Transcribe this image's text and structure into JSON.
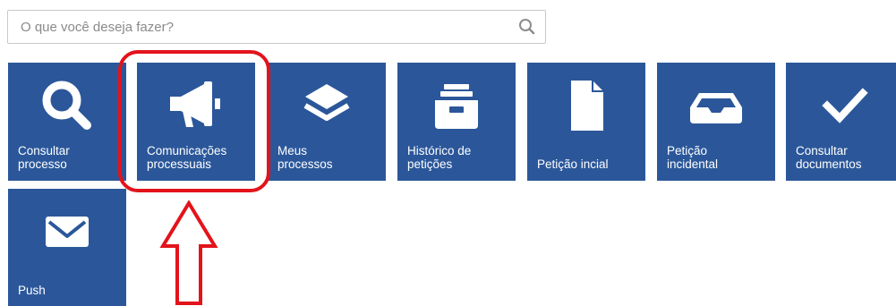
{
  "search": {
    "placeholder": "O que você deseja fazer?",
    "icon": "search-icon"
  },
  "tiles": [
    {
      "id": "consultar-processo",
      "label": "Consultar\nprocesso",
      "icon": "magnifier-icon"
    },
    {
      "id": "comunicacoes-processuais",
      "label": "Comunicações\nprocessuais",
      "icon": "megaphone-icon"
    },
    {
      "id": "meus-processos",
      "label": "Meus\nprocessos",
      "icon": "layers-icon"
    },
    {
      "id": "historico-de-peticoes",
      "label": "Histórico de\npetições",
      "icon": "archive-box-icon"
    },
    {
      "id": "peticao-incial",
      "label": "Petição incial",
      "icon": "document-icon"
    },
    {
      "id": "peticao-incidental",
      "label": "Petição\nincidental",
      "icon": "inbox-tray-icon"
    },
    {
      "id": "consultar-documentos",
      "label": "Consultar\ndocumentos",
      "icon": "checkmark-icon"
    },
    {
      "id": "push",
      "label": "Push",
      "icon": "envelope-icon"
    }
  ],
  "colors": {
    "tile": "#2b579a",
    "highlight": "#e3131b"
  }
}
